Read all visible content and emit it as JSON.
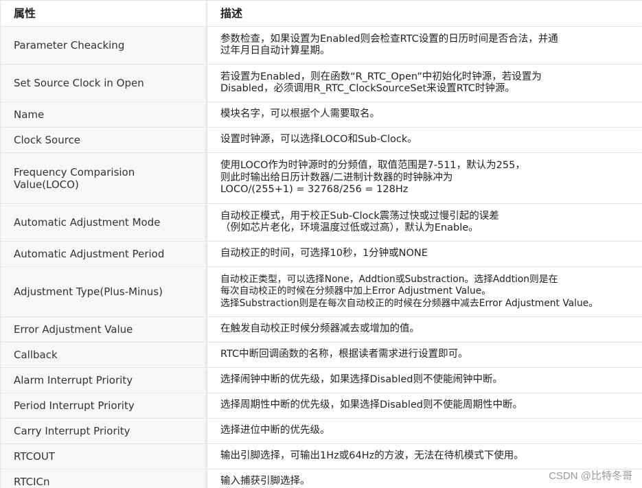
{
  "table": {
    "headers": [
      "属性",
      "描述"
    ],
    "rows": [
      {
        "prop": "Parameter Cheacking",
        "desc": "参数检查，如果设置为Enabled则会检查RTC设置的日历时间是否合法，并通\n过年月日自动计算星期。"
      },
      {
        "prop": "Set Source Clock in Open",
        "desc": "若设置为Enabled，则在函数“R_RTC_Open”中初始化时钟源，若设置为\nDisabled，必须调用R_RTC_ClockSourceSet来设置RTC时钟源。"
      },
      {
        "prop": "Name",
        "desc": "模块名字，可以根据个人需要取名。"
      },
      {
        "prop": "Clock Source",
        "desc": "设置时钟源，可以选择LOCO和Sub-Clock。"
      },
      {
        "prop": "Frequency Comparision Value(LOCO)",
        "desc": "使用LOCO作为时钟源时的分频值，取值范围是7-511，默认为255，\n则此时输出给日历计数器/二进制计数器的时钟脉冲为\nLOCO/(255+1) = 32768/256 = 128Hz"
      },
      {
        "prop": "Automatic Adjustment Mode",
        "desc": "自动校正模式，用于校正Sub-Clock震荡过快或过慢引起的误差\n（例如芯片老化，环境温度过低或过高），默认为Enable。"
      },
      {
        "prop": "Automatic Adjustment Period",
        "desc": "自动校正的时间，可选择10秒，1分钟或NONE"
      },
      {
        "prop": "Adjustment Type(Plus-Minus)",
        "desc": "自动校正类型，可以选择None，Addtion或Substraction。选择Addtion则是在\n每次自动校正的时候在分频器中加上Error Adjustment Value。\n选择Substraction则是在每次自动校正的时候在分频器中减去Error Adjustment Value。"
      },
      {
        "prop": "Error Adjustment Value",
        "desc": "在触发自动校正时候分频器减去或增加的值。"
      },
      {
        "prop": "Callback",
        "desc": "RTC中断回调函数的名称，根据读者需求进行设置即可。"
      },
      {
        "prop": "Alarm Interrupt Priority",
        "desc": "选择闹钟中断的优先级，如果选择Disabled则不使能闹钟中断。"
      },
      {
        "prop": "Period Interrupt Priority",
        "desc": "选择周期性中断的优先级，如果选择Disabled则不使能周期性中断。"
      },
      {
        "prop": "Carry Interrupt Priority",
        "desc": "选择进位中断的优先级。"
      },
      {
        "prop": "RTCOUT",
        "desc": "输出引脚选择，可输出1Hz或64Hz的方波，无法在待机模式下使用。"
      },
      {
        "prop": "RTCICn",
        "desc": "输入捕获引脚选择。"
      }
    ]
  },
  "watermark": "CSDN @比特冬哥"
}
